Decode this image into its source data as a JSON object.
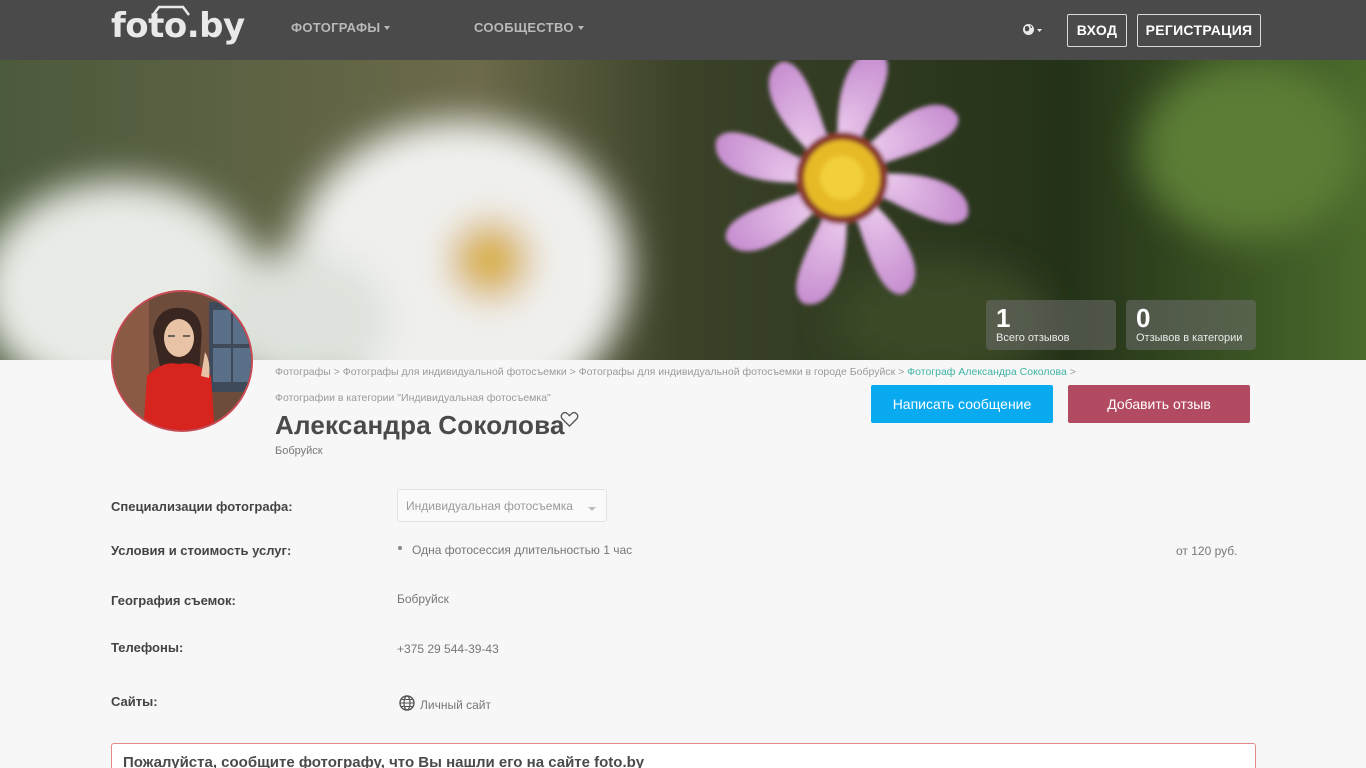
{
  "header": {
    "logo": "foto.by",
    "nav": [
      {
        "label": "ФОТОГРАФЫ"
      },
      {
        "label": "СООБЩЕСТВО"
      }
    ],
    "language_icon": "globe-icon",
    "login_label": "ВХОД",
    "register_label": "РЕГИСТРАЦИЯ"
  },
  "stats": [
    {
      "value": "1",
      "label": "Всего отзывов"
    },
    {
      "value": "0",
      "label": "Отзывов в категории"
    }
  ],
  "breadcrumb": {
    "line1": "Фотографы > Фотографы для индивидуальной фотосъемки > Фотографы для индивидуальной фотосъемки в городе Бобруйск >",
    "active": "Фотограф Александра Соколова",
    "after_active": ">",
    "line2": "Фотографии в категории \"Индивидуальная фотосъемка\""
  },
  "profile": {
    "name": "Александра Соколова",
    "city": "Бобруйск",
    "message_button": "Написать сообщение",
    "review_button": "Добавить отзыв"
  },
  "details": {
    "specializations_label": "Специализации фотографа:",
    "specialization_selected": "Индивидуальная фотосъемка",
    "services_label": "Условия и стоимость услуг:",
    "service_item": "Одна фотосессия длительностью 1 час",
    "service_price": "от 120 руб.",
    "geography_label": "География съемок:",
    "geography_value": "Бобруйск",
    "phones_label": "Телефоны:",
    "phone_value": "+375 29 544-39-43",
    "sites_label": "Сайты:",
    "site_value": "Личный сайт"
  },
  "notice": {
    "text": "Пожалуйста, сообщите фотографу, что Вы нашли его на сайте foto.by"
  },
  "colors": {
    "header_bg": "#4a4a4a",
    "message_button": "#0aaaf0",
    "review_button": "#b24a62",
    "breadcrumb_active": "#3fb3a4",
    "notice_border": "#e28a8a"
  }
}
